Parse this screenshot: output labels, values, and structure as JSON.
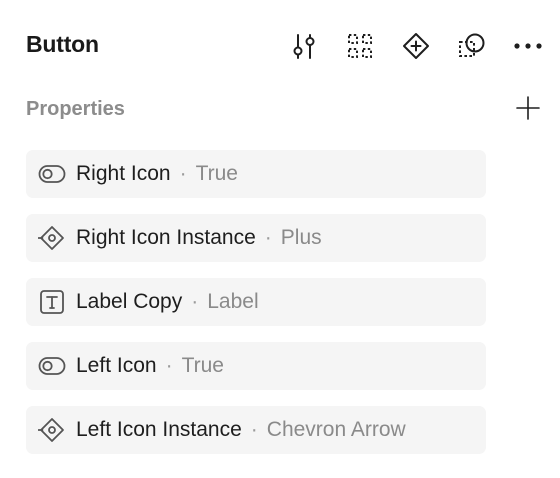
{
  "header": {
    "title": "Button",
    "toolbar": [
      "adjust-icon",
      "grid-dots-icon",
      "component-instance-icon",
      "swap-shape-icon",
      "more-icon"
    ]
  },
  "properties": {
    "title": "Properties",
    "add_icon": "plus-icon",
    "items": [
      {
        "icon": "boolean-toggle-icon",
        "name": "Right Icon",
        "separator": "·",
        "value": "True"
      },
      {
        "icon": "instance-swap-icon",
        "name": "Right Icon Instance",
        "separator": "·",
        "value": "Plus"
      },
      {
        "icon": "text-icon",
        "name": "Label Copy",
        "separator": "·",
        "value": "Label"
      },
      {
        "icon": "boolean-toggle-icon",
        "name": "Left Icon",
        "separator": "·",
        "value": "True"
      },
      {
        "icon": "instance-swap-icon",
        "name": "Left Icon Instance",
        "separator": "·",
        "value": "Chevron Arrow"
      }
    ]
  },
  "colors": {
    "text": "#1e1e1e",
    "muted": "#8a8a8a",
    "row_bg": "#f5f5f5"
  }
}
